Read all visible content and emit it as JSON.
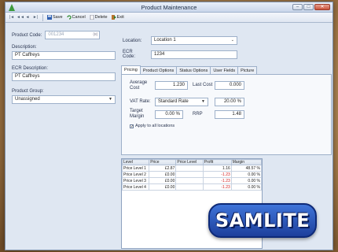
{
  "window": {
    "title": "Product Maintenance",
    "min": "–",
    "max": "□",
    "close": "✕"
  },
  "toolbar": {
    "nav": [
      "|◄",
      "◄◄",
      "◄",
      "►|"
    ],
    "save": "Save",
    "cancel": "Cancel",
    "delete": "Delete",
    "exit": "Exit"
  },
  "left": {
    "product_code_label": "Product Code:",
    "product_code_value": "001234",
    "description_label": "Description:",
    "description_value": "PT Caffreys",
    "ecr_desc_label": "ECR Description:",
    "ecr_desc_value": "PT Caffreys",
    "group_label": "Product Group:",
    "group_value": "Unassigned"
  },
  "right": {
    "location_label": "Location:",
    "location_value": "Location 1",
    "ecr_code_label": "ECR Code:",
    "ecr_code_value": "1234"
  },
  "tabs": [
    "Pricing",
    "Product Options",
    "Status Options",
    "User Fields",
    "Picture"
  ],
  "pricing": {
    "avg_cost_label": "Average Cost",
    "avg_cost_value": "1.230",
    "last_cost_label": "Last Cost",
    "last_cost_value": "0.000",
    "vat_label": "VAT Rate:",
    "vat_value": "Standard Rate",
    "vat_pct": "20.00 %",
    "target_label": "Target Margin",
    "target_value": "0.00 %",
    "rrp_label": "RRP",
    "rrp_value": "1.48",
    "apply_label": "Apply to all locations"
  },
  "grid": {
    "headers": [
      "Level",
      "Price",
      "Price Level",
      "Profit",
      "Margin"
    ],
    "rows": [
      [
        "Price Level 1",
        "£2.87",
        "",
        "1.16",
        "48.57 %"
      ],
      [
        "Price Level 2",
        "£0.00",
        "",
        "-1.23",
        "0.00 %"
      ],
      [
        "Price Level 3",
        "£0.00",
        "",
        "-1.23",
        "0.00 %"
      ],
      [
        "Price Level 4",
        "£0.00",
        "",
        "-1.23",
        "0.00 %"
      ]
    ]
  },
  "logo": {
    "text": "SAMLITE"
  },
  "colors": {
    "accent": "#2a56c6",
    "negative": "#d21a1a",
    "frame": "#dfe7f2"
  }
}
